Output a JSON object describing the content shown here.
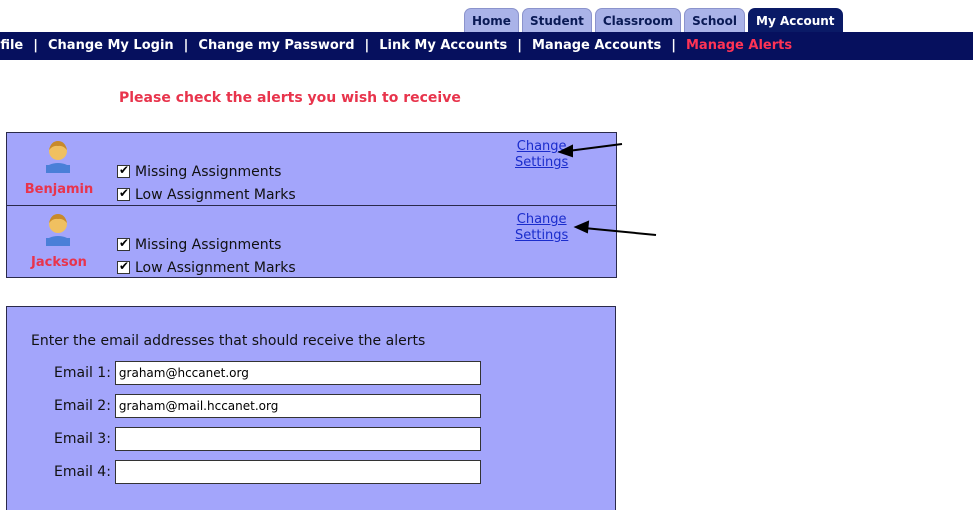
{
  "tabs": [
    "Home",
    "Student",
    "Classroom",
    "School",
    "My Account"
  ],
  "active_tab": "My Account",
  "subnav": {
    "items": [
      "rofile",
      "Change My Login",
      "Change my Password",
      "Link My Accounts",
      "Manage Accounts",
      "Manage Alerts"
    ],
    "separator": "|",
    "current": "Manage Alerts"
  },
  "heading": "Please check the alerts you wish to receive",
  "students": [
    {
      "name": "Benjamin",
      "alerts": [
        {
          "label": "Missing Assignments",
          "checked": true
        },
        {
          "label": "Low Assignment Marks",
          "checked": true
        }
      ],
      "change_link": [
        "Change",
        "Settings"
      ]
    },
    {
      "name": "Jackson",
      "alerts": [
        {
          "label": "Missing Assignments",
          "checked": true
        },
        {
          "label": "Low Assignment Marks",
          "checked": true
        }
      ],
      "change_link": [
        "Change",
        "Settings"
      ]
    }
  ],
  "emails": {
    "intro": "Enter the email addresses that should receive the alerts",
    "fields": [
      {
        "label": "Email 1:",
        "value": "graham@hccanet.org"
      },
      {
        "label": "Email 2:",
        "value": "graham@mail.hccanet.org"
      },
      {
        "label": "Email 3:",
        "value": ""
      },
      {
        "label": "Email 4:",
        "value": ""
      }
    ]
  },
  "colors": {
    "nav_bg": "#06105e",
    "tab_bg": "#aab3e8",
    "active_tab_bg": "#0a1a66",
    "panel_bg": "#a3a5fb",
    "accent_red": "#e8344c",
    "link_blue": "#1a2ccc"
  },
  "icons": {
    "avatar": "user-avatar-icon",
    "checkbox": "checkbox-checked-icon"
  }
}
